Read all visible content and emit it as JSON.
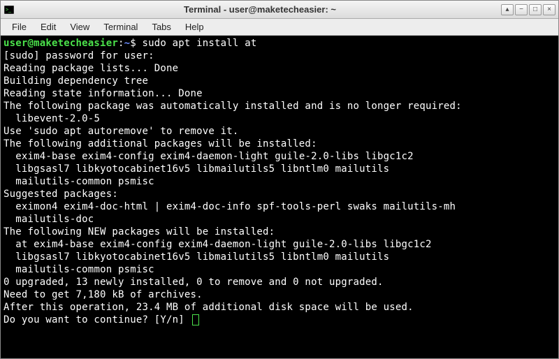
{
  "window": {
    "title": "Terminal - user@maketecheasier: ~"
  },
  "menubar": {
    "items": [
      "File",
      "Edit",
      "View",
      "Terminal",
      "Tabs",
      "Help"
    ]
  },
  "prompt": {
    "user_host": "user@maketecheasier",
    "separator": ":",
    "path": "~",
    "symbol": "$",
    "command": "sudo apt install at"
  },
  "output_lines": [
    "[sudo] password for user:",
    "Reading package lists... Done",
    "Building dependency tree",
    "Reading state information... Done",
    "The following package was automatically installed and is no longer required:",
    "  libevent-2.0-5",
    "Use 'sudo apt autoremove' to remove it.",
    "The following additional packages will be installed:",
    "  exim4-base exim4-config exim4-daemon-light guile-2.0-libs libgc1c2",
    "  libgsasl7 libkyotocabinet16v5 libmailutils5 libntlm0 mailutils",
    "  mailutils-common psmisc",
    "Suggested packages:",
    "  eximon4 exim4-doc-html | exim4-doc-info spf-tools-perl swaks mailutils-mh",
    "  mailutils-doc",
    "The following NEW packages will be installed:",
    "  at exim4-base exim4-config exim4-daemon-light guile-2.0-libs libgc1c2",
    "  libgsasl7 libkyotocabinet16v5 libmailutils5 libntlm0 mailutils",
    "  mailutils-common psmisc",
    "0 upgraded, 13 newly installed, 0 to remove and 0 not upgraded.",
    "Need to get 7,180 kB of archives.",
    "After this operation, 23.4 MB of additional disk space will be used.",
    "Do you want to continue? [Y/n] "
  ],
  "titlebar_buttons": {
    "up": "▴",
    "minimize": "−",
    "maximize": "□",
    "close": "×"
  }
}
